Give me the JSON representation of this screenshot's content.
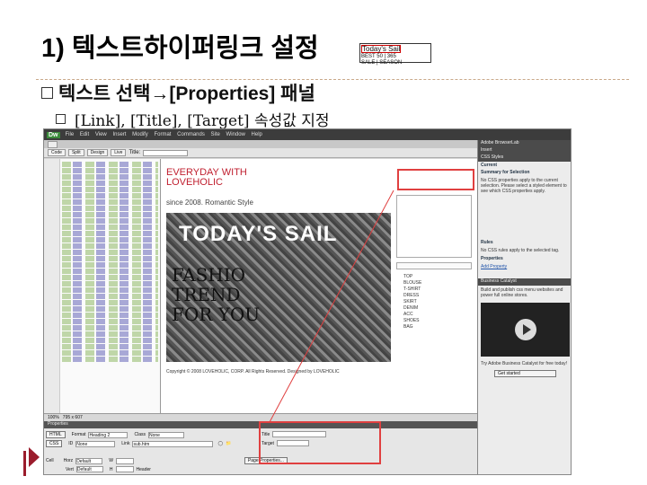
{
  "slide": {
    "title": "1) 텍스트하이퍼링크 설정",
    "bullet1": "텍스트 선택→[Properties] 패널",
    "bullet2": "[Link], [Title], [Target] 속성값 지정"
  },
  "dreamweaver": {
    "app_logo": "Dw",
    "menu": [
      "File",
      "Edit",
      "View",
      "Insert",
      "Modify",
      "Format",
      "Commands",
      "Site",
      "Window",
      "Help"
    ],
    "toolbar": {
      "code": "Code",
      "split": "Split",
      "design": "Design",
      "live": "Live",
      "title_label": "Title:"
    },
    "page": {
      "header_line1": "EVERYDAY WITH",
      "header_line2": "LOVEHOLIC",
      "since": "since 2008. Romantic Style",
      "banner": "TODAY'S SAIL",
      "fashion_lines": [
        "FASHIO",
        "TREND",
        "FOR YOU"
      ],
      "categories": [
        "TOP",
        "BLOUSE",
        "T-SHIRT",
        "DRESS",
        "SKIRT",
        "DENIM",
        "ACC",
        "SHOES",
        "BAG"
      ],
      "copyright": "Copyright © 2008 LOVEHOLIC, CORP. All Rights Reserved. Designed by LOVEHOLIC",
      "today_small_hl": "Today's Sail",
      "today_small_lines": [
        "BEST 50 | 365",
        "SALE | SEASON",
        "| REVIEW"
      ]
    },
    "status": {
      "zoom": "100%",
      "size": "795 x 607"
    },
    "properties": {
      "header": "Properties",
      "html_btn": "HTML",
      "css_btn": "CSS",
      "format_label": "Format",
      "format_value": "Heading 2",
      "id_label": "ID",
      "id_value": "None",
      "link_label": "Link",
      "link_value": "sub.htm",
      "title_label": "Title",
      "target_label": "Target",
      "class_label": "Class",
      "class_value": "None",
      "page_props_btn": "Page Properties...",
      "cell_label": "Cell",
      "horz_label": "Horz",
      "horz_value": "Default",
      "vert_label": "Vert",
      "vert_value": "Default",
      "w_label": "W",
      "h_label": "H",
      "header_cb_label": "Header"
    },
    "right_panel": {
      "browserlab": "Adobe BrowserLab",
      "insert": "Insert",
      "css_styles": "CSS Styles",
      "current": "Current",
      "summary": "Summary for Selection",
      "summary_text": "No CSS properties apply to the current selection. Please select a styled element to see which CSS properties apply.",
      "rules": "Rules",
      "rules_text": "No CSS rules apply to the selected tag.",
      "props": "Properties",
      "add_property": "Add Property",
      "business": "Business Catalyst",
      "business_text": "Build and publish css menu websites and power full online stores.",
      "try_text": "Try Adobe Business Catalyst for free today!",
      "get_started": "Get started",
      "files": "Files",
      "assets": "Assets"
    }
  }
}
